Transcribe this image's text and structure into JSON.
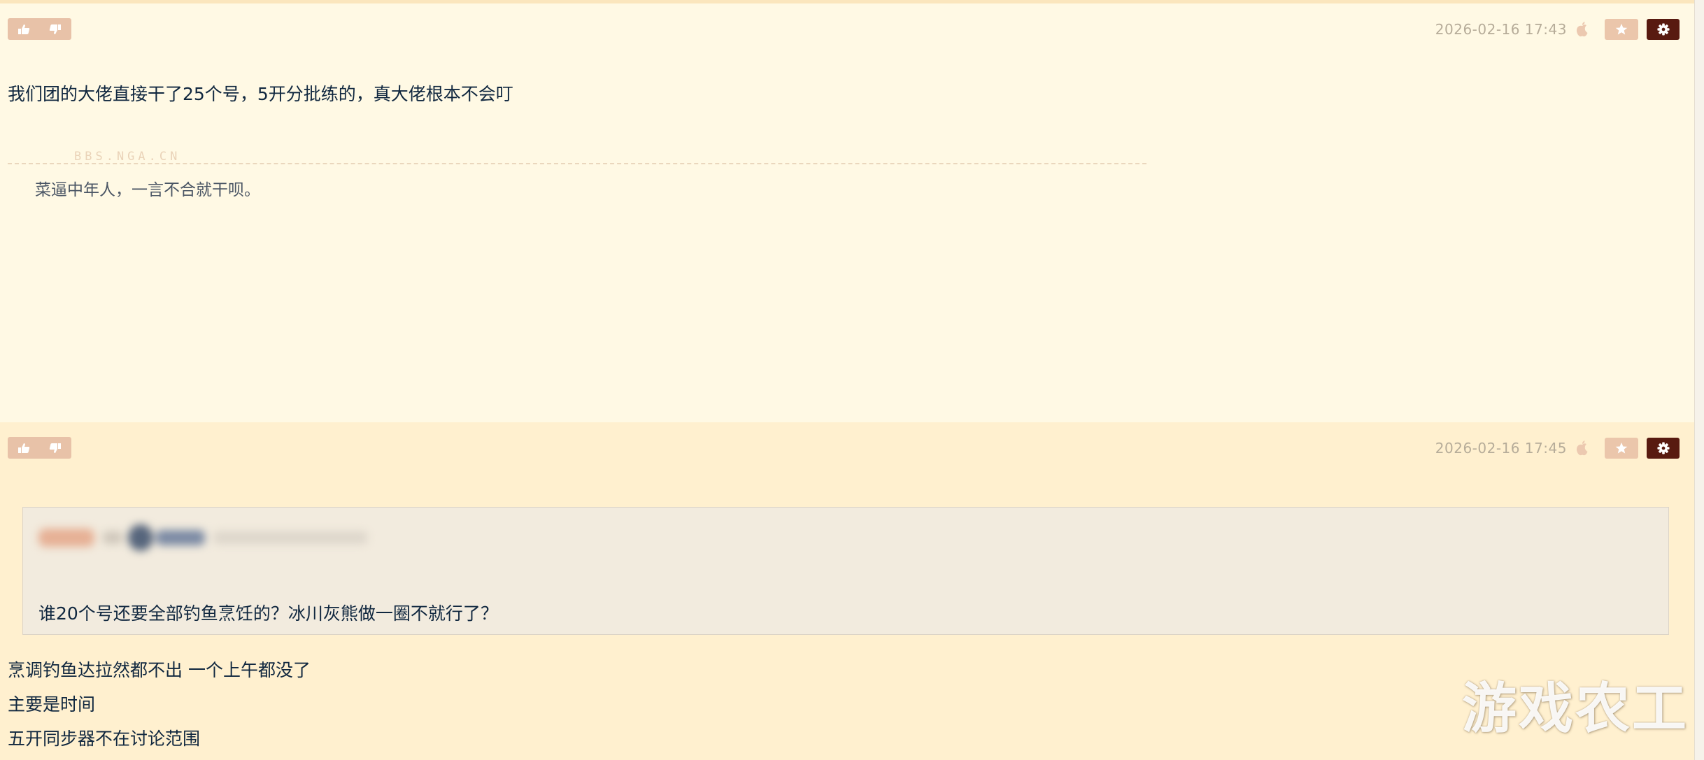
{
  "posts": [
    {
      "timestamp": "2026-02-16 17:43",
      "content": "我们团的大佬直接干了25个号，5开分批练的，真大佬根本不会叮",
      "watermark": "BBS.NGA.CN",
      "signature": "菜逼中年人，一言不合就干呗。"
    },
    {
      "timestamp": "2026-02-16 17:45",
      "quote": "谁20个号还要全部钓鱼烹饪的？冰川灰熊做一圈不就行了？",
      "lines": [
        "烹调钓鱼达拉然都不出 一个上午都没了",
        "主要是时间",
        "五开同步器不在讨论范围"
      ]
    }
  ],
  "overlay_brand": "游戏农工",
  "icons": {
    "upvote": "thumbs-up-icon",
    "downvote": "thumbs-down-icon",
    "device": "apple-icon",
    "favorite": "star-icon",
    "settings": "gear-icon"
  },
  "colors": {
    "post_bg_1": "#fff9e4",
    "post_bg_2": "#fff0cf",
    "vote_bg": "#e8c2a8",
    "settings_bg": "#581a10",
    "text": "#10273f"
  }
}
